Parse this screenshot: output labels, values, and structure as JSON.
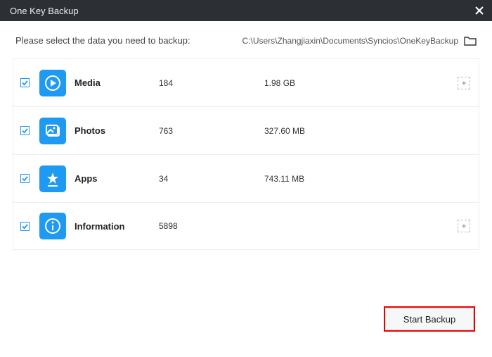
{
  "window": {
    "title": "One Key Backup",
    "close_icon": "close"
  },
  "header": {
    "instructions": "Please select the data you need to backup:",
    "backup_path": "C:\\Users\\Zhangjiaxin\\Documents\\Syncios\\OneKeyBackup",
    "folder_icon": "folder"
  },
  "items": [
    {
      "checked": true,
      "icon": "media",
      "name": "Media",
      "count": "184",
      "size": "1.98 GB",
      "expandable": true
    },
    {
      "checked": true,
      "icon": "photos",
      "name": "Photos",
      "count": "763",
      "size": "327.60 MB",
      "expandable": false
    },
    {
      "checked": true,
      "icon": "apps",
      "name": "Apps",
      "count": "34",
      "size": "743.11 MB",
      "expandable": false
    },
    {
      "checked": true,
      "icon": "information",
      "name": "Information",
      "count": "5898",
      "size": "",
      "expandable": true
    }
  ],
  "footer": {
    "start_button": "Start Backup"
  },
  "expand_glyph": "+"
}
